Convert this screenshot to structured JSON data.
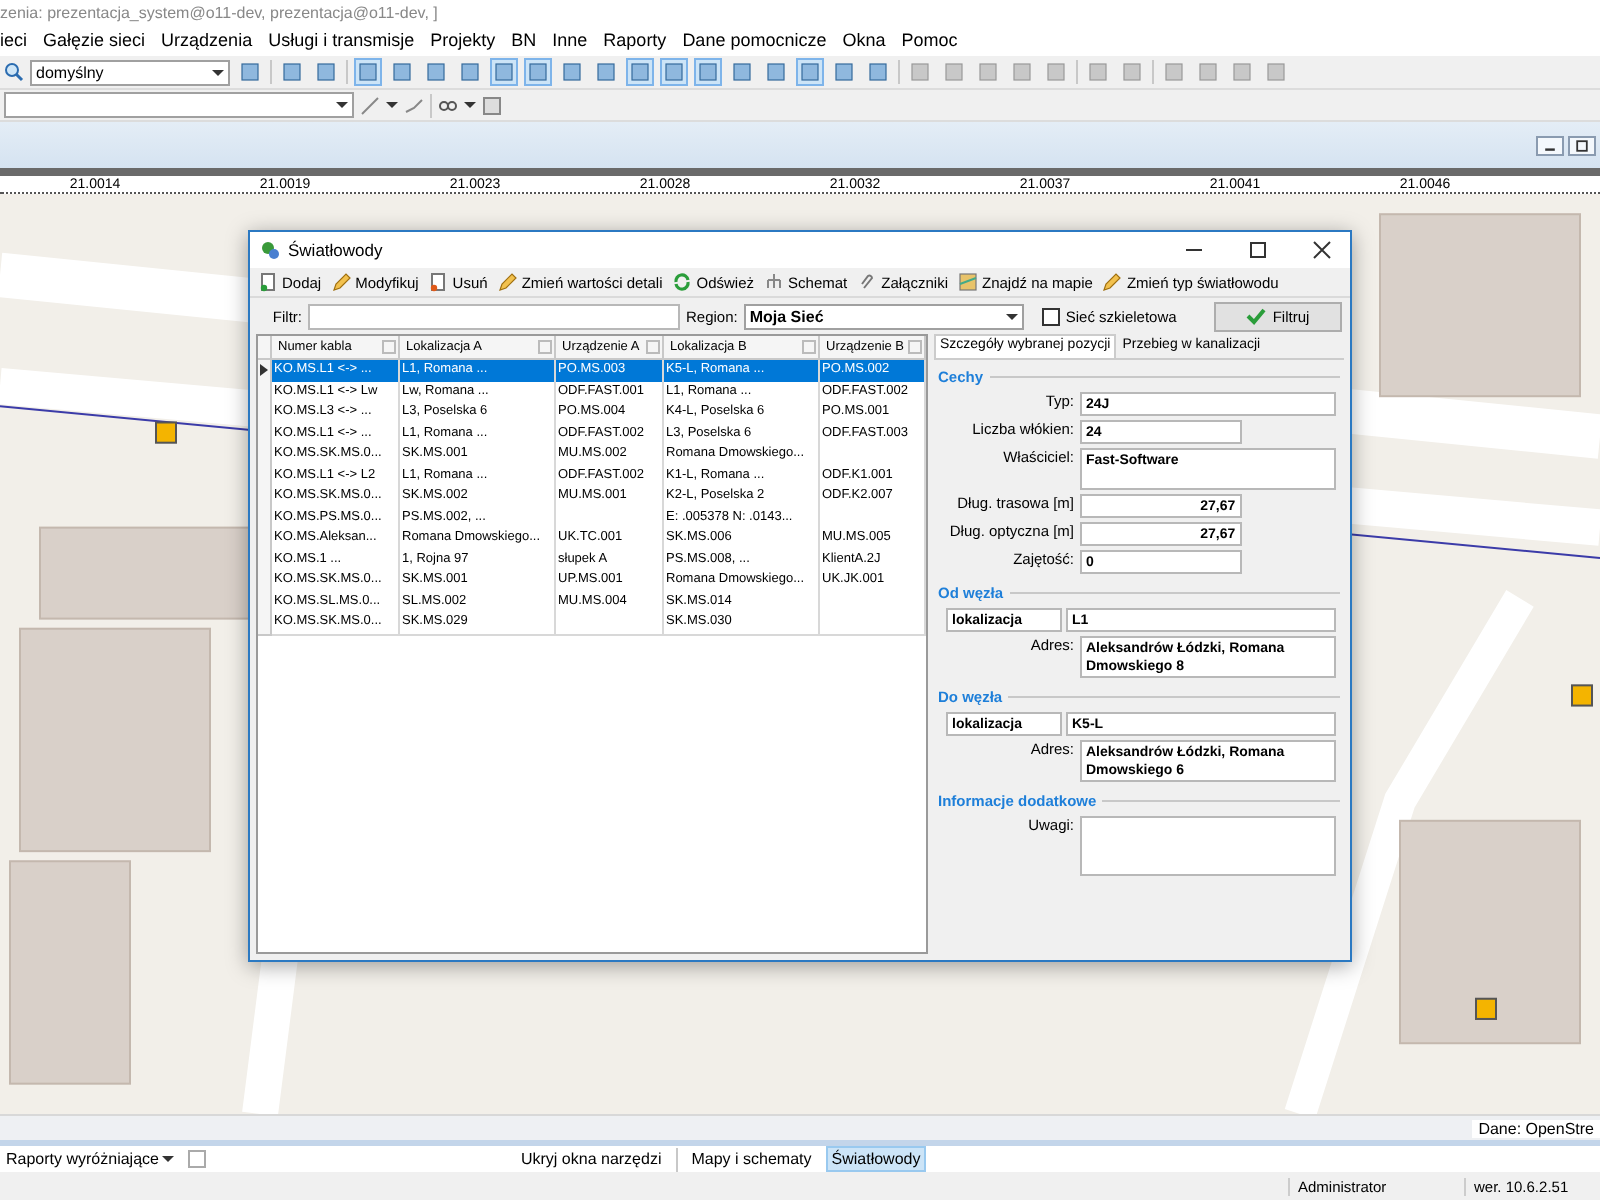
{
  "window": {
    "title": "zenia: prezentacja_system@o11-dev, prezentacja@o11-dev, ]"
  },
  "menu": [
    "ieci",
    "Gałęzie sieci",
    "Urządzenia",
    "Usługi i transmisje",
    "Projekty",
    "BN",
    "Inne",
    "Raporty",
    "Dane pomocnicze",
    "Okna",
    "Pomoc"
  ],
  "main_toolbar": {
    "profile": "domyślny",
    "buttons": [
      {
        "pressed": false
      },
      {
        "pressed": false
      },
      {
        "pressed": false
      },
      {
        "pressed": true
      },
      {
        "pressed": false
      },
      {
        "pressed": false
      },
      {
        "pressed": false
      },
      {
        "pressed": true
      },
      {
        "pressed": true
      },
      {
        "pressed": false
      },
      {
        "pressed": false
      },
      {
        "pressed": true
      },
      {
        "pressed": true
      },
      {
        "pressed": true
      },
      {
        "pressed": false
      },
      {
        "pressed": false
      },
      {
        "pressed": true
      },
      {
        "pressed": false
      },
      {
        "pressed": false
      },
      {
        "pressed": false
      },
      {
        "pressed": false
      },
      {
        "pressed": false
      },
      {
        "pressed": false
      },
      {
        "pressed": false
      },
      {
        "pressed": false
      },
      {
        "pressed": false
      },
      {
        "pressed": false
      },
      {
        "pressed": false
      },
      {
        "pressed": false
      },
      {
        "pressed": false
      }
    ]
  },
  "ruler": [
    "21.0014",
    "21.0019",
    "21.0023",
    "21.0028",
    "21.0032",
    "21.0037",
    "21.0041",
    "21.0046"
  ],
  "attribution": "Dane: OpenStre",
  "dialog": {
    "title": "Światłowody",
    "toolbar": [
      "Dodaj",
      "Modyfikuj",
      "Usuń",
      "Zmień wartości detali",
      "Odśwież",
      "Schemat",
      "Załączniki",
      "Znajdź na mapie",
      "Zmień typ światłowodu"
    ],
    "filter": {
      "label": "Filtr:",
      "region_label": "Region:",
      "region": "Moja Sieć",
      "backbone": {
        "label": "Sieć szkieletowa",
        "checked": false
      },
      "button": "Filtruj"
    },
    "table": {
      "columns": [
        "Numer kabla",
        "Lokalizacja A",
        "Urządzenie A",
        "Lokalizacja B",
        "Urządzenie B"
      ],
      "rows": [
        {
          "selected": true,
          "cells": [
            "KO.MS.L1 <-> ...",
            "L1, Romana ...",
            "PO.MS.003",
            "K5-L, Romana ...",
            "PO.MS.002"
          ]
        },
        {
          "selected": false,
          "cells": [
            "KO.MS.L1 <-> Lw",
            "Lw, Romana ...",
            "ODF.FAST.001",
            "L1, Romana ...",
            "ODF.FAST.002"
          ]
        },
        {
          "selected": false,
          "cells": [
            "KO.MS.L3 <-> ...",
            "L3, Poselska 6",
            "PO.MS.004",
            "K4-L, Poselska 6",
            "PO.MS.001"
          ]
        },
        {
          "selected": false,
          "cells": [
            "KO.MS.L1 <-> ...",
            "L1, Romana ...",
            "ODF.FAST.002",
            "L3, Poselska 6",
            "ODF.FAST.003"
          ]
        },
        {
          "selected": false,
          "cells": [
            "KO.MS.SK.MS.0...",
            "SK.MS.001",
            "MU.MS.002",
            "Romana Dmowskiego...",
            null
          ]
        },
        {
          "selected": false,
          "cells": [
            "KO.MS.L1 <-> L2",
            "L1, Romana ...",
            "ODF.FAST.002",
            "K1-L, Romana ...",
            "ODF.K1.001"
          ]
        },
        {
          "selected": false,
          "cells": [
            "KO.MS.SK.MS.0...",
            "SK.MS.002",
            "MU.MS.001",
            "K2-L, Poselska 2",
            "ODF.K2.007"
          ]
        },
        {
          "selected": false,
          "cells": [
            "KO.MS.PS.MS.0...",
            "PS.MS.002, ...",
            null,
            "E: .005378  N: .0143...",
            null
          ]
        },
        {
          "selected": false,
          "cells": [
            "KO.MS.Aleksan...",
            "Romana Dmowskiego...",
            "UK.TC.001",
            "SK.MS.006",
            "MU.MS.005"
          ]
        },
        {
          "selected": false,
          "cells": [
            "KO.MS.1 ...",
            "1, Rojna 97",
            "słupek A",
            "PS.MS.008, ...",
            "KlientA.2J"
          ]
        },
        {
          "selected": false,
          "cells": [
            "KO.MS.SK.MS.0...",
            "SK.MS.001",
            "UP.MS.001",
            "Romana Dmowskiego...",
            "UK.JK.001"
          ]
        },
        {
          "selected": false,
          "cells": [
            "KO.MS.SL.MS.0...",
            "SL.MS.002",
            "MU.MS.004",
            "SK.MS.014",
            null
          ]
        },
        {
          "selected": false,
          "cells": [
            "KO.MS.SK.MS.0...",
            "SK.MS.029",
            null,
            "SK.MS.030",
            null
          ]
        }
      ]
    },
    "tabs": [
      {
        "label": "Szczegóły wybranej pozycji",
        "selected": true
      },
      {
        "label": "Przebieg w kanalizacji",
        "selected": false
      }
    ],
    "sections": [
      {
        "title": "Cechy",
        "fields": [
          {
            "kind": "wide",
            "label": "Typ:",
            "value": "24J"
          },
          {
            "kind": "short",
            "label": "Liczba włókien:",
            "value": "24"
          },
          {
            "kind": "multiline",
            "label": "Właściciel:",
            "value": "Fast-Software"
          },
          {
            "kind": "number",
            "label": "Dług. trasowa [m]",
            "value": "27,67"
          },
          {
            "kind": "number",
            "label": "Dług. optyczna [m]",
            "value": "27,67"
          },
          {
            "kind": "short",
            "label": "Zajętość:",
            "value": "0"
          }
        ]
      },
      {
        "title": "Od węzła",
        "fields": [
          {
            "kind": "pair",
            "label": "lokalizacja",
            "value": "L1"
          },
          {
            "kind": "multiline",
            "label": "Adres:",
            "value": "Aleksandrów Łódzki, Romana Dmowskiego 8"
          }
        ]
      },
      {
        "title": "Do węzła",
        "fields": [
          {
            "kind": "pair",
            "label": "lokalizacja",
            "value": "K5-L"
          },
          {
            "kind": "multiline",
            "label": "Adres:",
            "value": "Aleksandrów Łódzki, Romana Dmowskiego 6"
          }
        ]
      },
      {
        "title": "Informacje dodatkowe",
        "fields": [
          {
            "kind": "multiline",
            "label": "Uwagi:"
          }
        ]
      }
    ]
  },
  "bottom_bar": {
    "reports": "Raporty wyróżniające",
    "reports_checked": false,
    "hide_tools": "Ukryj okna narzędzi",
    "tabs": [
      {
        "label": "Mapy i schematy",
        "selected": false
      },
      {
        "label": "Światłowody",
        "selected": true
      }
    ]
  },
  "status_bar": {
    "user": "Administrator",
    "version": "wer. 10.6.2.51"
  }
}
